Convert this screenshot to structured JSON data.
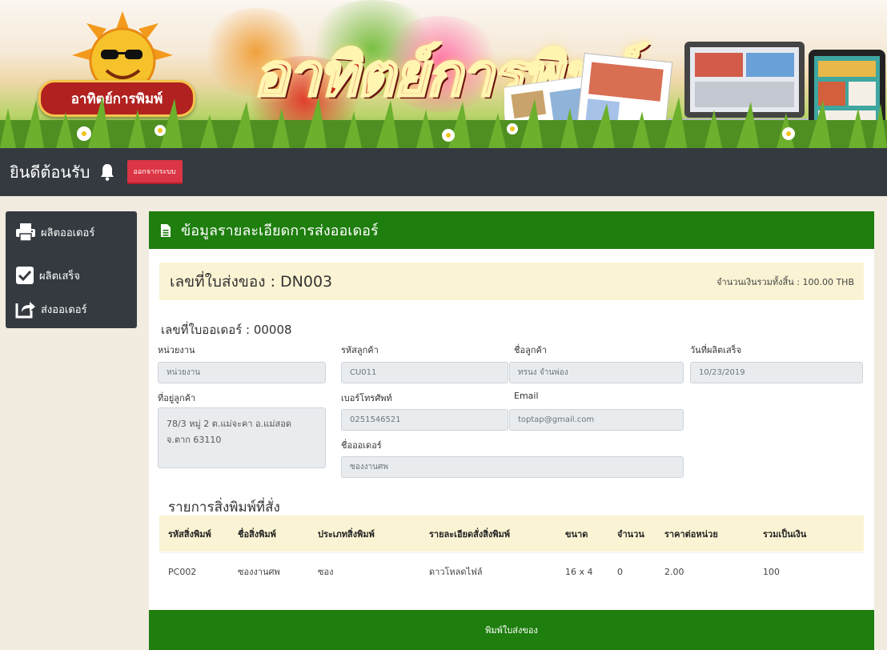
{
  "banner": {
    "logo_text": "อาทิตย์การพิมพ์",
    "title": "อาทิตย์การพิมพ์"
  },
  "topnav": {
    "welcome": "ยินดีต้อนรับ",
    "logout_label": "ออกจากระบบ"
  },
  "sidebar": {
    "items": [
      {
        "label": "ผลิตออเดอร์",
        "icon": "printer-icon"
      },
      {
        "label": "ผลิตเสร็จ",
        "icon": "checkbox-icon"
      },
      {
        "label": "ส่งออเดอร์",
        "icon": "share-icon"
      }
    ]
  },
  "panel": {
    "title": "ข้อมูลรายละเอียดการส่งออเดอร์",
    "delivery_no": "เลขที่ใบส่งของ : DN003",
    "total": "จำนวนเงินรวมทั้งสิ้น : 100.00 THB",
    "order_no": "เลขที่ใบออเดอร์ : 00008"
  },
  "form": {
    "unit_label": "หน่วยงาน",
    "unit_value": "หน่วยงาน",
    "customer_code_label": "รหัสลูกค้า",
    "customer_code_value": "CU011",
    "customer_name_label": "ชื่อลูกค้า",
    "customer_name_value": "ทรนง จำนพ่อง",
    "finish_date_label": "วันที่ผลิตเสร็จ",
    "finish_date_value": "10/23/2019",
    "address_label": "ที่อยู่ลูกค้า",
    "address_value": "78/3 หมู่ 2 ต.แม่จะคา อ.แม่สอด จ.ตาก 63110",
    "phone_label": "เบอร์โทรศัพท์",
    "phone_value": "0251546521",
    "email_label": "Email",
    "email_value": "toptap@gmail.com",
    "order_name_label": "ชื่อออเดอร์",
    "order_name_value": "ซองงานศพ"
  },
  "items": {
    "title": "รายการสิ่งพิมพ์ที่สั่ง",
    "headers": [
      "รหัสสิ่งพิมพ์",
      "ชื่อสิ่งพิมพ์",
      "ประเภทสิ่งพิมพ์",
      "รายละเอียดสั่งสิ่งพิมพ์",
      "ขนาด",
      "จำนวน",
      "ราคาต่อหน่วย",
      "รวมเป็นเงิน"
    ],
    "rows": [
      [
        "PC002",
        "ซองงานศพ",
        "ซอง",
        "ดาวโหลดไฟล์",
        "16 x 4",
        "0",
        "2.00",
        "100"
      ]
    ]
  },
  "print_label": "พิมพ์ใบส่งของ",
  "colors": {
    "header_green": "#1e7e0e",
    "nav_dark": "#343a40",
    "danger_red": "#dc3545",
    "highlight_yellow": "#fbf4d4"
  }
}
